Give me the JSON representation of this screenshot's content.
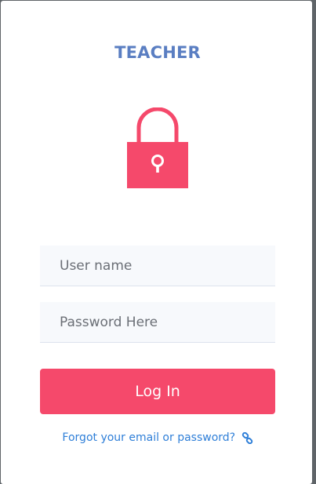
{
  "header": {
    "title": "TEACHER"
  },
  "icons": {
    "lock": "lock-icon",
    "link": "link-icon"
  },
  "form": {
    "username_placeholder": "User name",
    "username_value": "",
    "password_placeholder": "Password Here",
    "password_value": "",
    "login_label": "Log In",
    "forgot_label": "Forgot your email or password?"
  },
  "colors": {
    "accent": "#f5496b",
    "title": "#5a7ec2",
    "link": "#2f7fd8",
    "field_bg": "#f7f9fc"
  }
}
